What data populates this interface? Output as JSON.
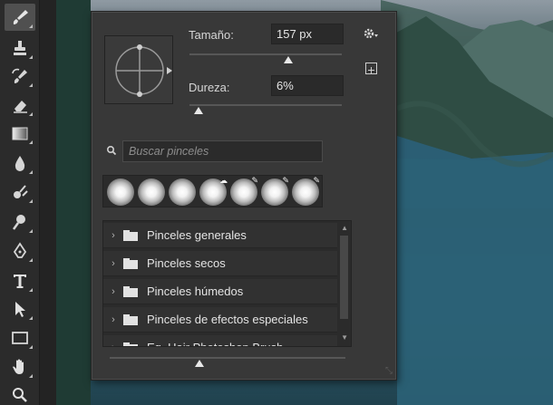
{
  "toolbar": {
    "tools": [
      {
        "name": "brush-tool",
        "icon": "brush-icon",
        "active": true
      },
      {
        "name": "clone-stamp-tool",
        "icon": "stamp-icon"
      },
      {
        "name": "history-brush-tool",
        "icon": "history-brush-icon"
      },
      {
        "name": "eraser-tool",
        "icon": "eraser-icon"
      },
      {
        "name": "gradient-tool",
        "icon": "gradient-icon"
      },
      {
        "name": "blur-tool",
        "icon": "drop-icon"
      },
      {
        "name": "dodge-tool",
        "icon": "dodge-icon"
      },
      {
        "name": "zoom-tool",
        "icon": "magnifier-icon"
      },
      {
        "name": "pen-tool",
        "icon": "pen-icon"
      },
      {
        "name": "type-tool",
        "icon": "type-icon"
      },
      {
        "name": "path-selection-tool",
        "icon": "arrow-icon"
      },
      {
        "name": "rectangle-tool",
        "icon": "rectangle-icon"
      },
      {
        "name": "hand-tool",
        "icon": "hand-icon"
      },
      {
        "name": "zoom-view-tool",
        "icon": "search-icon"
      }
    ]
  },
  "brush_panel": {
    "size_label": "Tamaño:",
    "size_value": "157 px",
    "size_fraction": 0.65,
    "hardness_label": "Dureza:",
    "hardness_value": "6%",
    "hardness_fraction": 0.06,
    "search_placeholder": "Buscar pinceles",
    "brush_tips_count": 7,
    "folders": [
      "Pinceles generales",
      "Pinceles secos",
      "Pinceles húmedos",
      "Pinceles de efectos especiales",
      "Eq. Hair Photoshop Brush"
    ],
    "preview_fraction": 0.38
  },
  "colors": {
    "panel_bg": "#383838",
    "field_bg": "#2a2a2a",
    "text": "#d6d6d6"
  }
}
